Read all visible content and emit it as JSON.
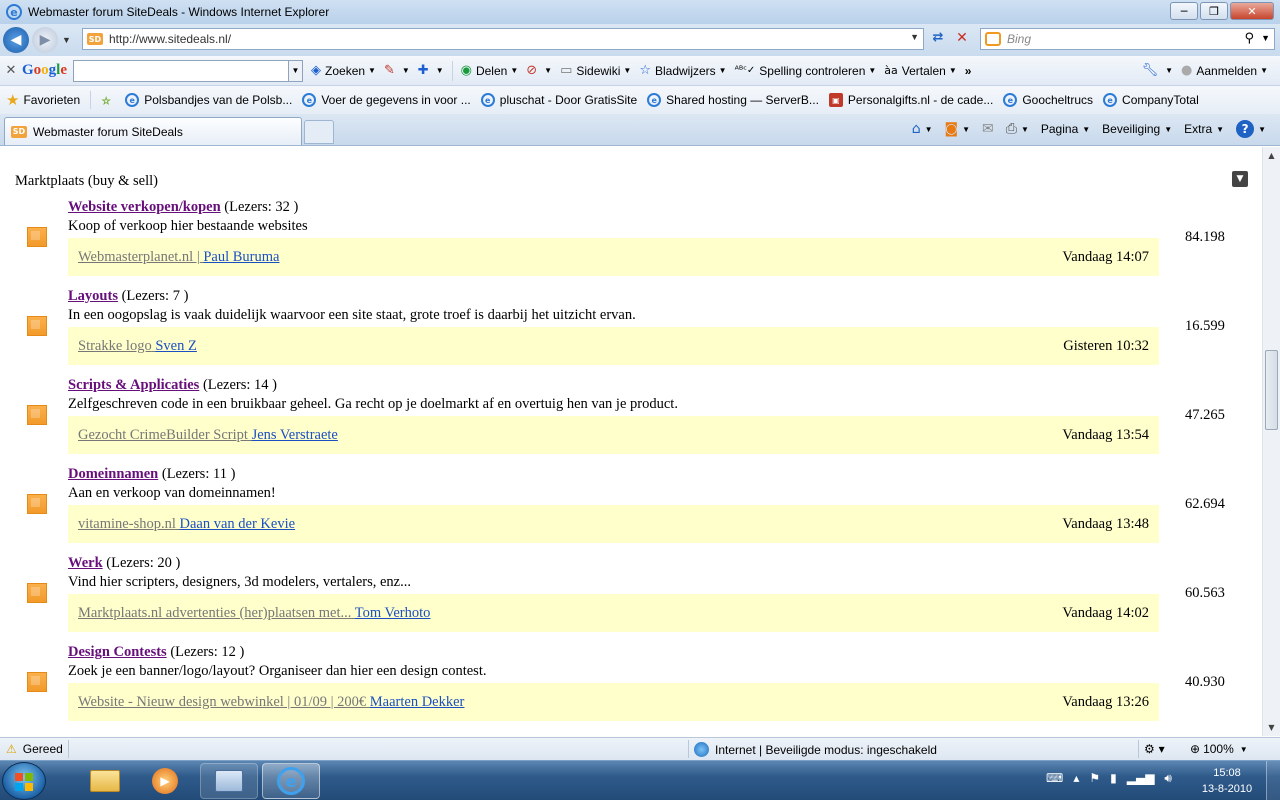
{
  "window": {
    "title": "Webmaster forum SiteDeals - Windows Internet Explorer",
    "minimize": "─",
    "maximize": "❐",
    "close": "✕"
  },
  "address": {
    "url": "http://www.sitedeals.nl/",
    "favicon_text": "SD"
  },
  "search": {
    "placeholder": "Bing"
  },
  "google_toolbar": {
    "logo": [
      "G",
      "o",
      "o",
      "g",
      "l",
      "e"
    ],
    "items": [
      {
        "label": "Zoeken",
        "icon": "search-g-icon"
      },
      {
        "label": "",
        "icon": "bookmark-icon"
      },
      {
        "label": "",
        "icon": "plus-icon"
      },
      {
        "label": "Delen",
        "icon": "share-icon"
      },
      {
        "label": "",
        "icon": "pagerank-icon"
      },
      {
        "label": "Sidewiki",
        "icon": "sidewiki-icon"
      },
      {
        "label": "Bladwijzers",
        "icon": "star-icon"
      },
      {
        "label": "Spelling controleren",
        "icon": "spellcheck-icon"
      },
      {
        "label": "Vertalen",
        "icon": "translate-icon"
      }
    ],
    "more": "»",
    "signin": "Aanmelden"
  },
  "favorites": {
    "label": "Favorieten",
    "links": [
      "Polsbandjes van de Polsb...",
      "Voer de gegevens in voor ...",
      "pluschat - Door GratisSite",
      "Shared hosting — ServerB...",
      "Personalgifts.nl - de cade...",
      "Goocheltrucs",
      "CompanyTotal"
    ]
  },
  "tabs": {
    "active": "Webmaster forum SiteDeals",
    "commands": [
      "Pagina",
      "Beveiliging",
      "Extra"
    ]
  },
  "content": {
    "section_title": "Marktplaats (buy & sell)",
    "forums": [
      {
        "name": "Website verkopen/kopen",
        "readers": "(Lezers: 32 )",
        "description": "Koop of verkoop hier bestaande websites",
        "last_topic": "Webmasterplanet.nl |",
        "last_user": "Paul Buruma",
        "last_time": "Vandaag 14:07",
        "count": "84.198"
      },
      {
        "name": "Layouts",
        "readers": "(Lezers: 7 )",
        "description": "In een oogopslag is vaak duidelijk waarvoor een site staat, grote troef is daarbij het uitzicht ervan.",
        "last_topic": "Strakke logo",
        "last_user": "Sven Z",
        "last_time": "Gisteren 10:32",
        "count": "16.599"
      },
      {
        "name": "Scripts & Applicaties",
        "readers": "(Lezers: 14 )",
        "description": "Zelfgeschreven code in een bruikbaar geheel. Ga recht op je doelmarkt af en overtuig hen van je product.",
        "last_topic": "Gezocht CrimeBuilder Script",
        "last_user": "Jens Verstraete",
        "last_time": "Vandaag 13:54",
        "count": "47.265"
      },
      {
        "name": "Domeinnamen",
        "readers": "(Lezers: 11 )",
        "description": "Aan en verkoop van domeinnamen!",
        "last_topic": "vitamine-shop.nl",
        "last_user": "Daan van der Kevie",
        "last_time": "Vandaag 13:48",
        "count": "62.694"
      },
      {
        "name": "Werk",
        "readers": "(Lezers: 20 )",
        "description": "Vind hier scripters, designers, 3d modelers, vertalers, enz...",
        "last_topic": "Marktplaats.nl advertenties (her)plaatsen met...",
        "last_user": "Tom Verhoto",
        "last_time": "Vandaag 14:02",
        "count": "60.563"
      },
      {
        "name": "Design Contests",
        "readers": "(Lezers: 12 )",
        "description": "Zoek je een banner/logo/layout? Organiseer dan hier een design contest.",
        "last_topic": "Website - Nieuw design webwinkel | 01/09 | 200€",
        "last_user": "Maarten Dekker",
        "last_time": "Vandaag 13:26",
        "count": "40.930"
      }
    ]
  },
  "statusbar": {
    "status": "Gereed",
    "zone": "Internet | Beveiligde modus: ingeschakeld",
    "zoom": "100%"
  },
  "taskbar": {
    "time": "15:08",
    "date": "13-8-2010"
  },
  "colors": {
    "forum_link": "#660e7a",
    "user_link": "#1c4fc1",
    "lastpost_bg": "#ffffcc",
    "forum_icon": "#f29a2a"
  }
}
